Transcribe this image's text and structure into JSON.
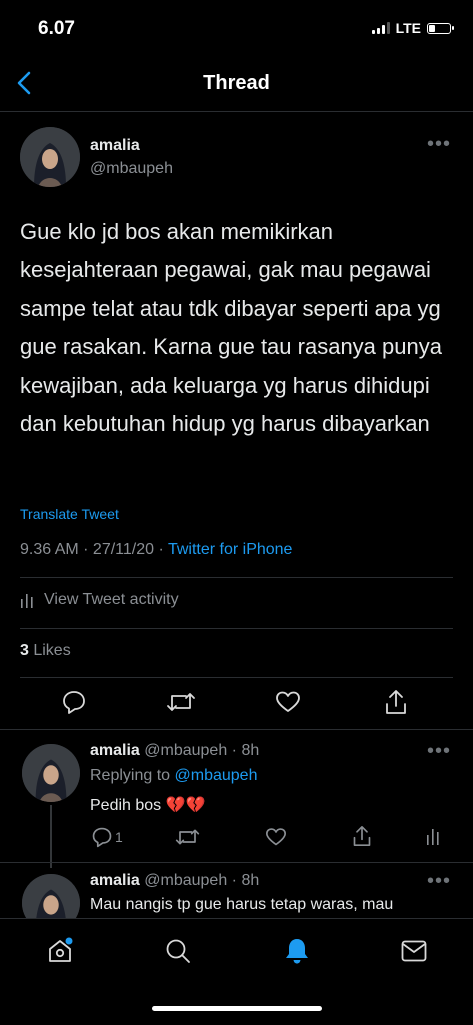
{
  "status_bar": {
    "time": "6.07",
    "network": "LTE",
    "battery_level": 0.25
  },
  "nav": {
    "back_icon": "chevron-left-icon",
    "title": "Thread"
  },
  "main_tweet": {
    "name": "amalia",
    "handle": "@mbaupeh",
    "text": "Gue klo jd bos akan memikirkan kesejahteraan pegawai, gak mau pegawai sampe telat atau tdk dibayar seperti apa yg gue rasakan. Karna gue tau rasanya punya kewajiban, ada keluarga yg harus dihidupi dan kebutuhan hidup yg harus dibayarkan",
    "translate_label": "Translate Tweet",
    "time_date": "9.36 AM · 27/11/20 · ",
    "source": "Twitter for iPhone",
    "activity_label": "View Tweet activity",
    "likes_count": "3",
    "likes_label": " Likes"
  },
  "replies": [
    {
      "name": "amalia",
      "meta": " @mbaupeh · 8h",
      "replying_prefix": "Replying to ",
      "replying_handle": "@mbaupeh",
      "text": "Pedih bos 💔💔",
      "reply_count": "1"
    },
    {
      "name": "amalia",
      "meta": " @mbaupeh · 8h",
      "text": "Mau nangis tp gue harus tetap waras, mau"
    }
  ],
  "tab_bar": {
    "items": [
      "home-icon",
      "search-icon",
      "notifications-icon",
      "messages-icon"
    ],
    "active": "notifications-icon"
  },
  "colors": {
    "background": "#000000",
    "accent": "#1d9bf0",
    "text": "#e7e9ea",
    "secondary": "#8b8f94"
  }
}
